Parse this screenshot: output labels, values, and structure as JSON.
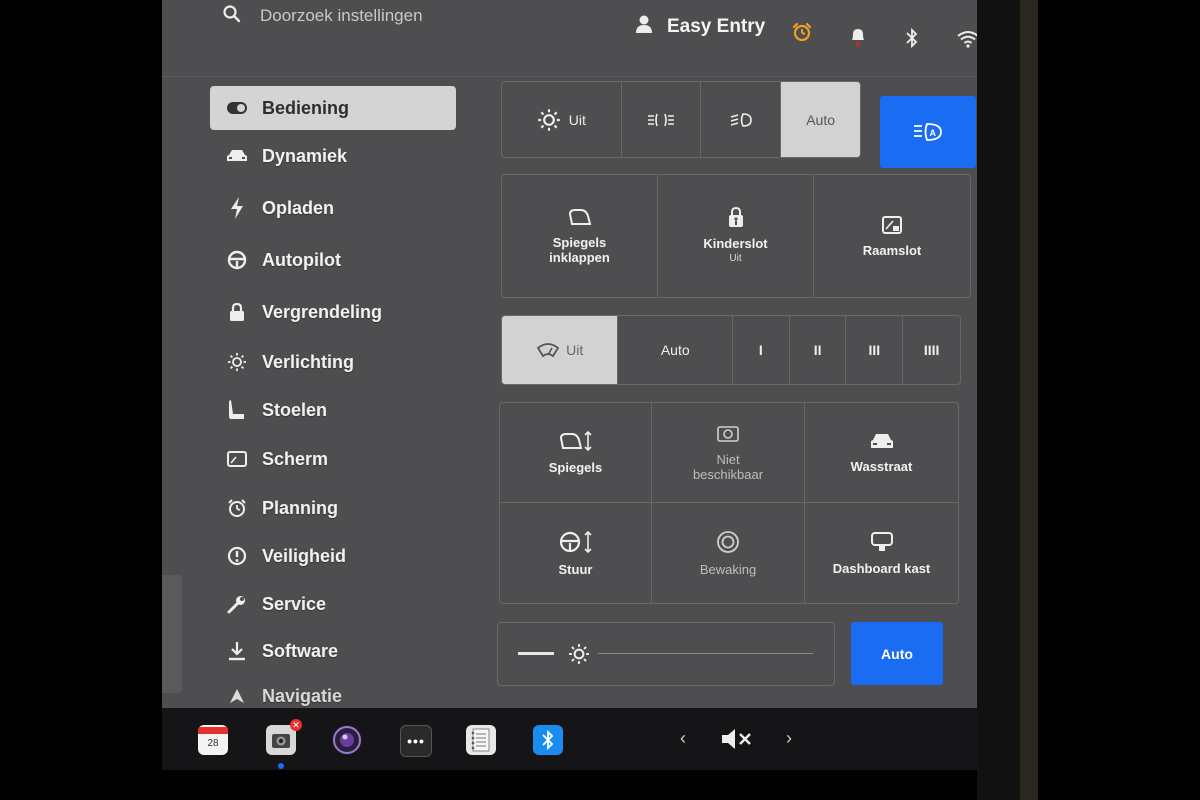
{
  "topbar": {
    "search_placeholder": "Doorzoek instellingen",
    "profile_name": "Easy Entry"
  },
  "sidebar": {
    "items": [
      {
        "label": "Bediening",
        "icon": "toggle-icon",
        "active": true
      },
      {
        "label": "Dynamiek",
        "icon": "car-icon"
      },
      {
        "label": "Opladen",
        "icon": "bolt-icon"
      },
      {
        "label": "Autopilot",
        "icon": "steering-wheel-icon"
      },
      {
        "label": "Vergrendeling",
        "icon": "lock-icon"
      },
      {
        "label": "Verlichting",
        "icon": "sun-icon"
      },
      {
        "label": "Stoelen",
        "icon": "seat-icon"
      },
      {
        "label": "Scherm",
        "icon": "display-icon"
      },
      {
        "label": "Planning",
        "icon": "alarm-clock-icon"
      },
      {
        "label": "Veiligheid",
        "icon": "alert-icon"
      },
      {
        "label": "Service",
        "icon": "wrench-icon"
      },
      {
        "label": "Software",
        "icon": "download-icon"
      },
      {
        "label": "Navigatie",
        "icon": "navigation-icon"
      }
    ]
  },
  "lights": {
    "off_label": "Uit",
    "auto_label": "Auto",
    "selected": "Auto"
  },
  "quick": {
    "mirrors_fold": "Spiegels inklappen",
    "child_lock": "Kinderslot",
    "child_lock_state": "Uit",
    "window_lock": "Raamslot"
  },
  "wipers": {
    "off_label": "Uit",
    "auto_label": "Auto",
    "speeds": [
      "I",
      "II",
      "III",
      "IIII"
    ],
    "selected": "Uit"
  },
  "tiles": {
    "mirrors": "Spiegels",
    "unavailable": "Niet beschikbaar",
    "car_wash": "Wasstraat",
    "steering": "Stuur",
    "sentry": "Bewaking",
    "glovebox": "Dashboard kast"
  },
  "brightness": {
    "auto_label": "Auto",
    "level": 0.12
  },
  "dock": {
    "calendar_day": "28"
  },
  "colors": {
    "accent_blue": "#1a6cf2",
    "screen_bg": "#4e4e50",
    "selected_segment": "#d2d2d2",
    "alarm_orange": "#f0a020"
  }
}
